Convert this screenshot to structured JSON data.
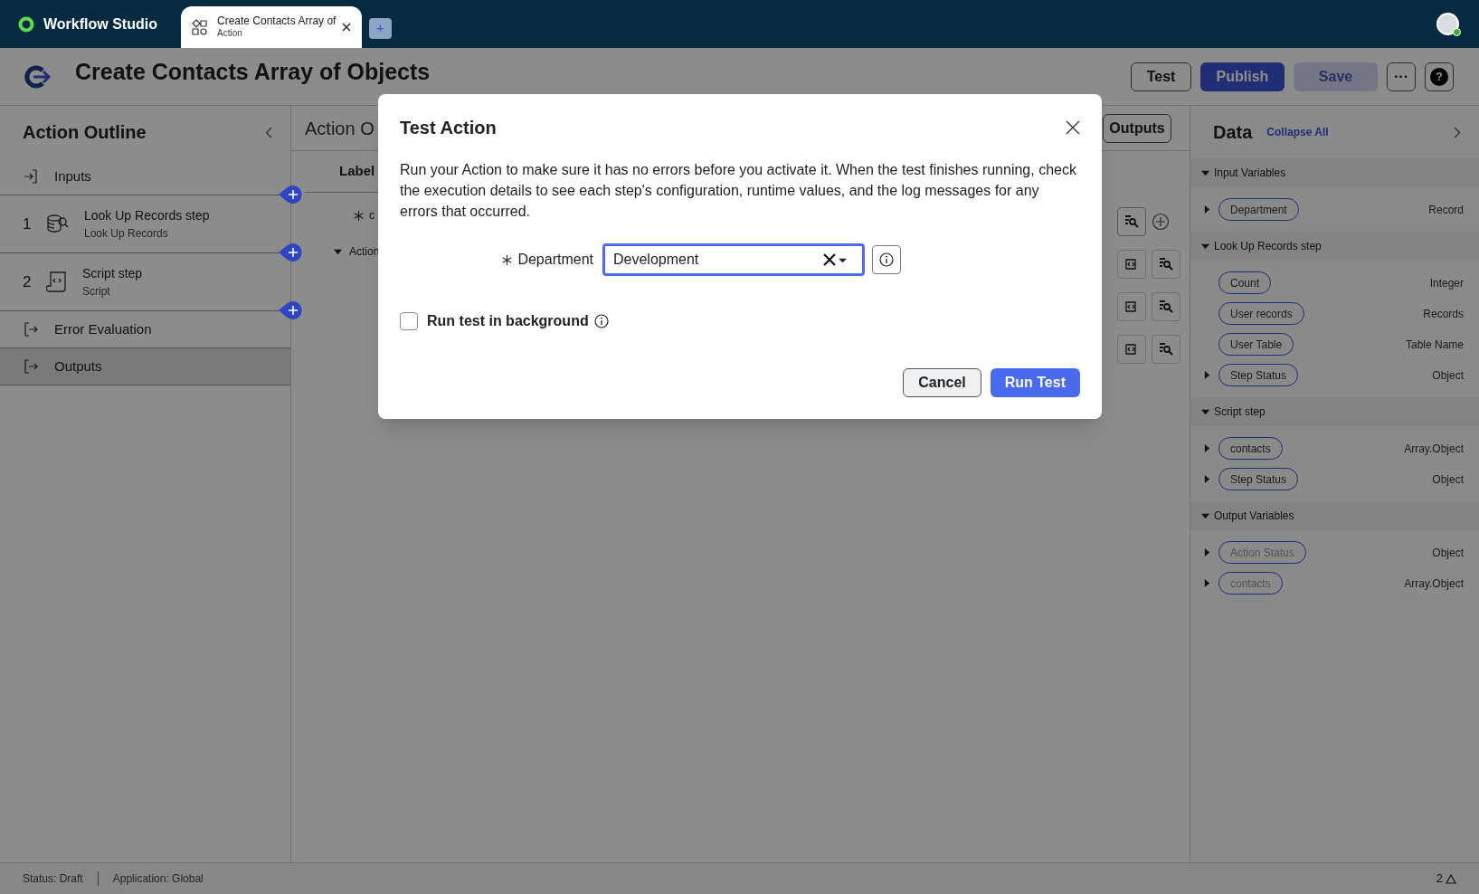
{
  "app": {
    "name": "Workflow Studio"
  },
  "tabs": [
    {
      "title": "Create Contacts Array of",
      "subtitle": "Action",
      "selected": true
    }
  ],
  "new_tab": "+",
  "header": {
    "title": "Create Contacts Array of Objects",
    "buttons": [
      {
        "label": "Test",
        "kind": "outline",
        "disabled": false
      },
      {
        "label": "Publish",
        "kind": "primary",
        "disabled": false
      },
      {
        "label": "Save",
        "kind": "primary",
        "disabled": true
      },
      {
        "label": "···",
        "kind": "outline",
        "disabled": false
      },
      {
        "label": "?",
        "kind": "help",
        "disabled": false
      }
    ]
  },
  "outline": {
    "title": "Action Outline",
    "items": [
      {
        "kind": "input",
        "label": "Inputs",
        "selected": false
      },
      {
        "kind": "lookup",
        "number": "1",
        "label": "Look Up Records step",
        "subtitle": "Look Up Records",
        "selected": false
      },
      {
        "kind": "script",
        "number": "2",
        "label": "Script step",
        "subtitle": "Script",
        "selected": false
      },
      {
        "kind": "output",
        "label": "Error Evaluation",
        "selected": false
      },
      {
        "kind": "output",
        "label": "Outputs",
        "selected": true
      }
    ]
  },
  "editor": {
    "heading": "Action O",
    "outputs_button": "Outputs",
    "column_label": "Label",
    "field_fragment": "c",
    "tree_row": "Action"
  },
  "data_panel": {
    "title": "Data",
    "collapse_all": "Collapse All",
    "sections": [
      {
        "title": "Input Variables",
        "expanded": true,
        "items": [
          {
            "label": "Department",
            "type": "Record",
            "expandable": true,
            "disabled": false
          }
        ]
      },
      {
        "title": "Look Up Records step",
        "expanded": true,
        "items": [
          {
            "label": "Count",
            "type": "Integer",
            "expandable": false,
            "disabled": false
          },
          {
            "label": "User records",
            "type": "Records",
            "expandable": false,
            "disabled": false
          },
          {
            "label": "User Table",
            "type": "Table Name",
            "expandable": false,
            "disabled": false
          },
          {
            "label": "Step Status",
            "type": "Object",
            "expandable": true,
            "disabled": false
          }
        ]
      },
      {
        "title": "Script step",
        "expanded": true,
        "items": [
          {
            "label": "contacts",
            "type": "Array.Object",
            "expandable": true,
            "disabled": false
          },
          {
            "label": "Step Status",
            "type": "Object",
            "expandable": true,
            "disabled": false
          }
        ]
      },
      {
        "title": "Output Variables",
        "expanded": true,
        "items": [
          {
            "label": "Action Status",
            "type": "Object",
            "expandable": true,
            "disabled": true
          },
          {
            "label": "contacts",
            "type": "Array.Object",
            "expandable": true,
            "disabled": true
          }
        ]
      }
    ]
  },
  "status_bar": {
    "status": "Status: Draft",
    "application": "Application: Global",
    "warnings": "2"
  },
  "dialog": {
    "title": "Test Action",
    "description": "Run your Action to make sure it has no errors before you activate it. When the test finishes running, check the execution details to see each step's configuration, runtime values, and the log messages for any errors that occurred.",
    "field": {
      "label": "Department",
      "required": true,
      "value": "Development",
      "focused": true
    },
    "checkbox": {
      "label": "Run test in background",
      "checked": false
    },
    "buttons": [
      {
        "label": "Cancel",
        "kind": "secondary"
      },
      {
        "label": "Run Test",
        "kind": "primary"
      }
    ]
  }
}
